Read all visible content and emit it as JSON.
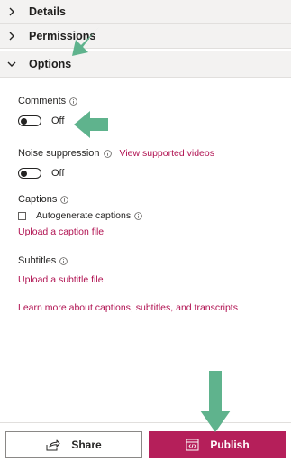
{
  "sections": {
    "details": "Details",
    "permissions": "Permissions",
    "options": "Options"
  },
  "comments": {
    "label": "Comments",
    "toggle_state": "Off"
  },
  "noise": {
    "label": "Noise suppression",
    "link": "View supported videos",
    "toggle_state": "Off"
  },
  "captions": {
    "label": "Captions",
    "checkbox_label": "Autogenerate captions",
    "upload_link": "Upload a caption file"
  },
  "subtitles": {
    "label": "Subtitles",
    "upload_link": "Upload a subtitle file"
  },
  "learn_more": "Learn more about captions, subtitles, and transcripts",
  "footer": {
    "share": "Share",
    "publish": "Publish"
  },
  "colors": {
    "accent": "#b51f5a",
    "link": "#b01050",
    "annotation_arrow": "#5fb38d"
  }
}
